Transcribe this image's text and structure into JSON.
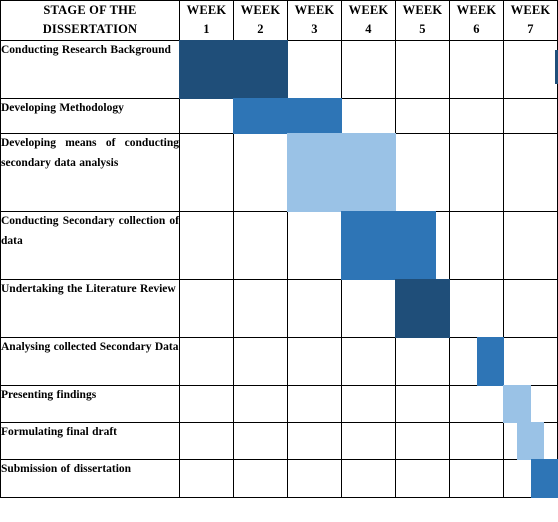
{
  "table": {
    "header": {
      "stage_label_line1": "STAGE OF THE",
      "stage_label_line2": "DISSERTATION",
      "week_word": "WEEK",
      "weeks": [
        "1",
        "2",
        "3",
        "4",
        "5",
        "6",
        "7"
      ]
    },
    "colors": {
      "dark_navy": "#1f4e79",
      "medium_blue": "#2e75b6",
      "light_blue": "#9ac2e6",
      "grid_line": "#000000",
      "cell_background": "#ffffff",
      "text": "#000000"
    },
    "rows": [
      {
        "stage": "Conducting Research Background",
        "bars": [
          {
            "week": 1,
            "color": "#1f4e79",
            "span": "full"
          },
          {
            "week": 2,
            "color": "#1f4e79",
            "span": "full"
          }
        ]
      },
      {
        "stage": "Developing Methodology",
        "bars": [
          {
            "week": 2,
            "color": "#2e75b6",
            "span": "full"
          },
          {
            "week": 3,
            "color": "#2e75b6",
            "span": "full"
          }
        ]
      },
      {
        "stage": "Developing means of conducting secondary data analysis",
        "bars": [
          {
            "week": 3,
            "color": "#9ac2e6",
            "span": "full"
          },
          {
            "week": 4,
            "color": "#9ac2e6",
            "span": "full"
          }
        ]
      },
      {
        "stage": "Conducting Secondary collection of data",
        "bars": [
          {
            "week": 4,
            "color": "#2e75b6",
            "span": "full"
          },
          {
            "week": 5,
            "color": "#2e75b6",
            "span": "leftwide"
          }
        ]
      },
      {
        "stage": "Undertaking the Literature Review",
        "bars": [
          {
            "week": 5,
            "color": "#1f4e79",
            "span": "full"
          }
        ]
      },
      {
        "stage": "Analysing collected Secondary Data",
        "bars": [
          {
            "week": 6,
            "color": "#2e75b6",
            "span": "right"
          }
        ]
      },
      {
        "stage": "Presenting findings",
        "bars": [
          {
            "week": 7,
            "color": "#9ac2e6",
            "span": "left"
          }
        ]
      },
      {
        "stage": "Formulating final draft",
        "bars": [
          {
            "week": 7,
            "color": "#9ac2e6",
            "span": "mid"
          }
        ]
      },
      {
        "stage": "Submission of dissertation",
        "bars": [
          {
            "week": 7,
            "color": "#2e75b6",
            "span": "right"
          }
        ]
      }
    ]
  }
}
